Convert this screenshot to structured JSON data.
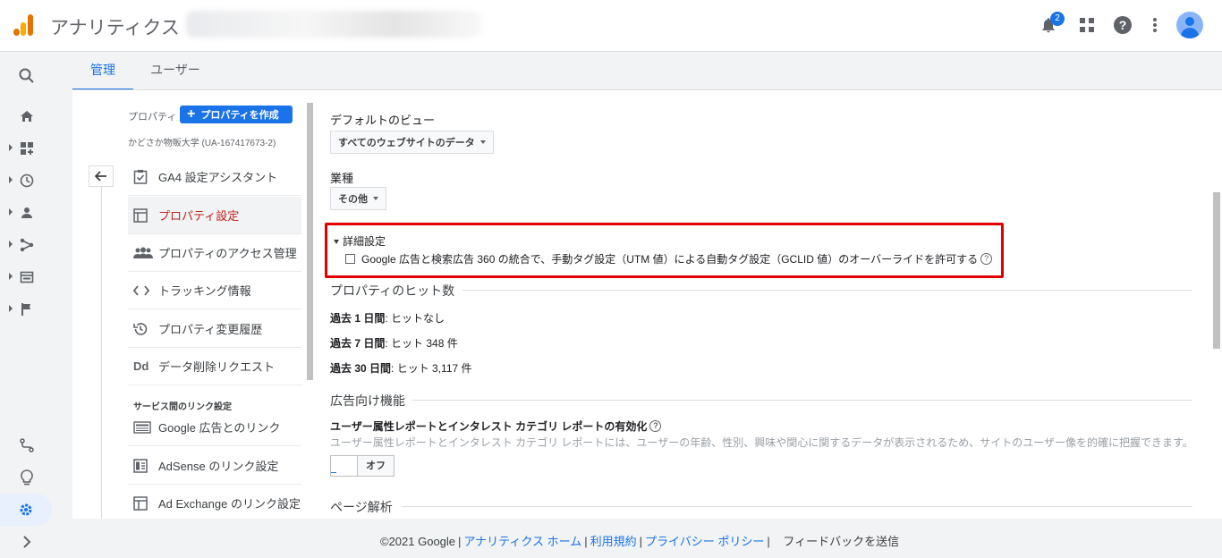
{
  "app": {
    "title": "アナリティクス"
  },
  "topbar": {
    "notifications_count": "2",
    "icons": [
      "bell-icon",
      "apps-icon",
      "help-icon",
      "more-vert-icon",
      "account-icon"
    ]
  },
  "tabs": [
    {
      "label": "管理"
    },
    {
      "label": "ユーザー"
    }
  ],
  "property": {
    "label": "プロパティ",
    "create_button": "プロパティを作成",
    "account_name": "かどさか物販大学 (UA-167417673-2)",
    "nav": [
      {
        "label": "GA4 設定アシスタント",
        "icon": "clipboard-check-icon"
      },
      {
        "label": "プロパティ設定",
        "icon": "layout-icon"
      },
      {
        "label": "プロパティのアクセス管理",
        "icon": "people-icon"
      },
      {
        "label": "トラッキング情報",
        "icon": "code-icon"
      },
      {
        "label": "プロパティ変更履歴",
        "icon": "history-icon"
      },
      {
        "label": "データ削除リクエスト",
        "icon": "dd-icon"
      }
    ],
    "link_section": "サービス間のリンク設定",
    "links": [
      {
        "label": "Google 広告とのリンク",
        "icon": "ads-icon"
      },
      {
        "label": "AdSense のリンク設定",
        "icon": "adsense-icon"
      },
      {
        "label": "Ad Exchange のリンク設定",
        "icon": "adx-icon"
      }
    ]
  },
  "settings": {
    "default_view_label": "デフォルトのビュー",
    "default_view_value": "すべてのウェブサイトのデータ",
    "industry_label": "業種",
    "industry_value": "その他",
    "advanced_title": "詳細設定",
    "advanced_checkbox": "Google 広告と検索広告 360 の統合で、手動タグ設定（UTM 値）による自動タグ設定（GCLID 値）のオーバーライドを許可する",
    "hits_title": "プロパティのヒット数",
    "hits": [
      {
        "period": "過去 1 日間",
        "value": ": ヒットなし"
      },
      {
        "period": "過去 7 日間",
        "value": ": ヒット 348 件"
      },
      {
        "period": "過去 30 日間",
        "value": ": ヒット 3,117 件"
      }
    ],
    "ads_title": "広告向け機能",
    "demographics_label": "ユーザー属性レポートとインタレスト カテゴリ レポートの有効化",
    "demographics_desc": "ユーザー属性レポートとインタレスト カテゴリ レポートには、ユーザーの年齢、性別、興味や関心に関するデータが表示されるため、サイトのユーザー像を的確に把握できます。",
    "toggle_off": "オフ",
    "page_analysis_title": "ページ解析"
  },
  "footer": {
    "copyright": "©2021 Google",
    "links": [
      "アナリティクス ホーム",
      "利用規約",
      "プライバシー ポリシー"
    ],
    "feedback": "フィードバックを送信"
  }
}
